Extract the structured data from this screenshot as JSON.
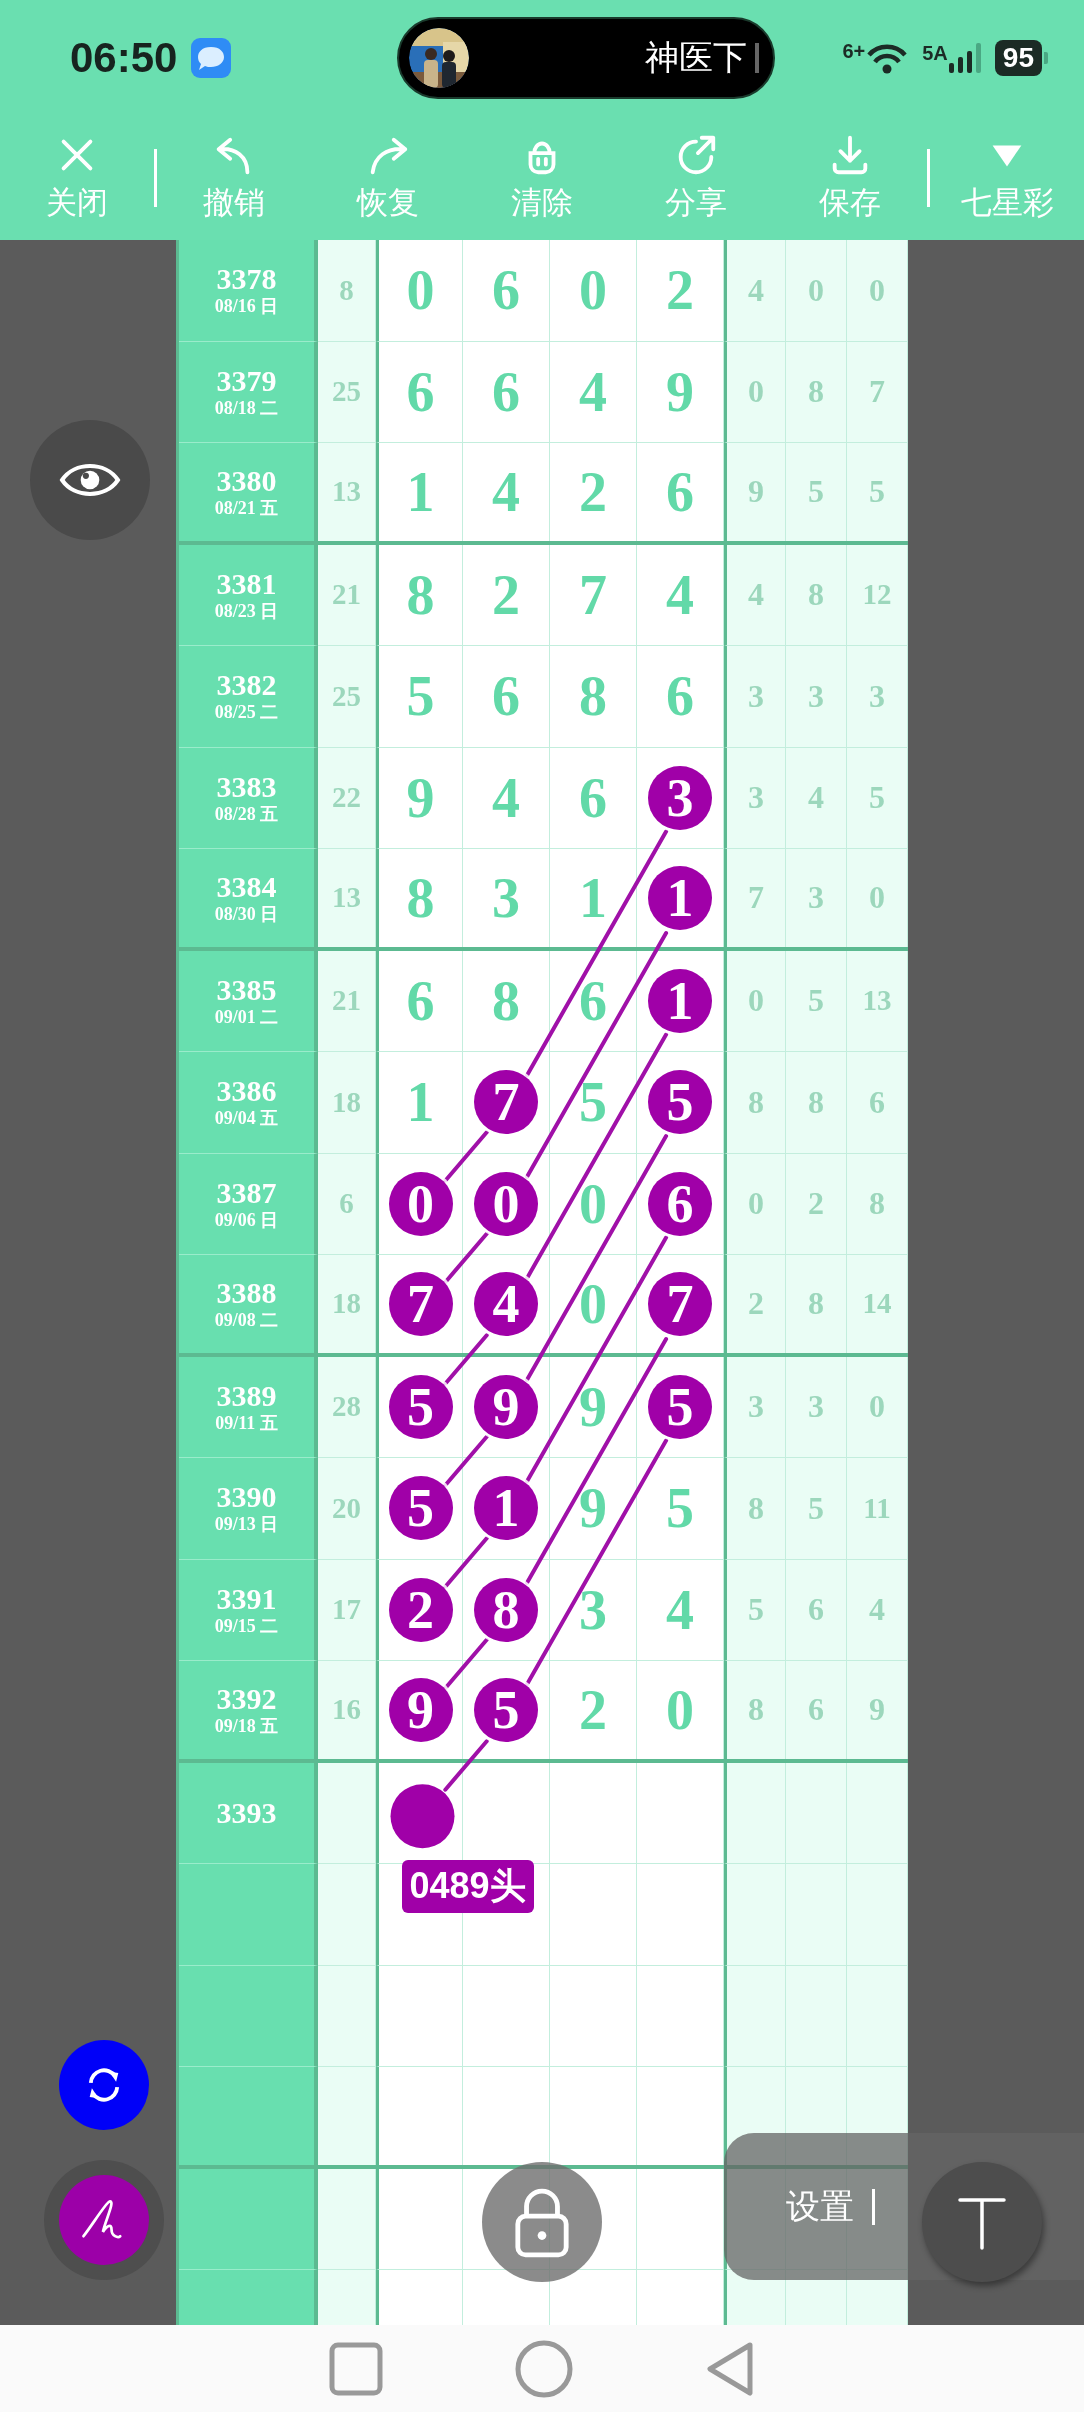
{
  "status_bar": {
    "time": "06:50",
    "media_title": "神医下",
    "wifi_label": "6+",
    "network_label": "5A",
    "battery": "95"
  },
  "toolbar": {
    "items": [
      {
        "kind": "close",
        "label": "关闭",
        "divider_before": false
      },
      {
        "kind": "undo",
        "label": "撤销",
        "divider_before": true
      },
      {
        "kind": "redo",
        "label": "恢复",
        "divider_before": false
      },
      {
        "kind": "clear",
        "label": "清除",
        "divider_before": false
      },
      {
        "kind": "share",
        "label": "分享",
        "divider_before": false
      },
      {
        "kind": "save",
        "label": "保存",
        "divider_before": false
      },
      {
        "kind": "menu",
        "label": "七星彩",
        "divider_before": true
      }
    ]
  },
  "rows": [
    {
      "period": "3378",
      "date": "08/16 日",
      "sum": "8",
      "digits": [
        {
          "value": "0",
          "circled": false
        },
        {
          "value": "6",
          "circled": false
        },
        {
          "value": "0",
          "circled": false
        },
        {
          "value": "2",
          "circled": false
        }
      ],
      "extra": [
        "4",
        "0",
        "0"
      ],
      "divider_below": false
    },
    {
      "period": "3379",
      "date": "08/18 二",
      "sum": "25",
      "digits": [
        {
          "value": "6",
          "circled": false
        },
        {
          "value": "6",
          "circled": false
        },
        {
          "value": "4",
          "circled": false
        },
        {
          "value": "9",
          "circled": false
        }
      ],
      "extra": [
        "0",
        "8",
        "7"
      ],
      "divider_below": false
    },
    {
      "period": "3380",
      "date": "08/21 五",
      "sum": "13",
      "digits": [
        {
          "value": "1",
          "circled": false
        },
        {
          "value": "4",
          "circled": false
        },
        {
          "value": "2",
          "circled": false
        },
        {
          "value": "6",
          "circled": false
        }
      ],
      "extra": [
        "9",
        "5",
        "5"
      ],
      "divider_below": true
    },
    {
      "period": "3381",
      "date": "08/23 日",
      "sum": "21",
      "digits": [
        {
          "value": "8",
          "circled": false
        },
        {
          "value": "2",
          "circled": false
        },
        {
          "value": "7",
          "circled": false
        },
        {
          "value": "4",
          "circled": false
        }
      ],
      "extra": [
        "4",
        "8",
        "12"
      ],
      "divider_below": false
    },
    {
      "period": "3382",
      "date": "08/25 二",
      "sum": "25",
      "digits": [
        {
          "value": "5",
          "circled": false
        },
        {
          "value": "6",
          "circled": false
        },
        {
          "value": "8",
          "circled": false
        },
        {
          "value": "6",
          "circled": false
        }
      ],
      "extra": [
        "3",
        "3",
        "3"
      ],
      "divider_below": false
    },
    {
      "period": "3383",
      "date": "08/28 五",
      "sum": "22",
      "digits": [
        {
          "value": "9",
          "circled": false
        },
        {
          "value": "4",
          "circled": false
        },
        {
          "value": "6",
          "circled": false
        },
        {
          "value": "3",
          "circled": true
        }
      ],
      "extra": [
        "3",
        "4",
        "5"
      ],
      "divider_below": false
    },
    {
      "period": "3384",
      "date": "08/30 日",
      "sum": "13",
      "digits": [
        {
          "value": "8",
          "circled": false
        },
        {
          "value": "3",
          "circled": false
        },
        {
          "value": "1",
          "circled": false
        },
        {
          "value": "1",
          "circled": true
        }
      ],
      "extra": [
        "7",
        "3",
        "0"
      ],
      "divider_below": true
    },
    {
      "period": "3385",
      "date": "09/01 二",
      "sum": "21",
      "digits": [
        {
          "value": "6",
          "circled": false
        },
        {
          "value": "8",
          "circled": false
        },
        {
          "value": "6",
          "circled": false
        },
        {
          "value": "1",
          "circled": true
        }
      ],
      "extra": [
        "0",
        "5",
        "13"
      ],
      "divider_below": false
    },
    {
      "period": "3386",
      "date": "09/04 五",
      "sum": "18",
      "digits": [
        {
          "value": "1",
          "circled": false
        },
        {
          "value": "7",
          "circled": true
        },
        {
          "value": "5",
          "circled": false
        },
        {
          "value": "5",
          "circled": true
        }
      ],
      "extra": [
        "8",
        "8",
        "6"
      ],
      "divider_below": false
    },
    {
      "period": "3387",
      "date": "09/06 日",
      "sum": "6",
      "digits": [
        {
          "value": "0",
          "circled": true
        },
        {
          "value": "0",
          "circled": true
        },
        {
          "value": "0",
          "circled": false
        },
        {
          "value": "6",
          "circled": true
        }
      ],
      "extra": [
        "0",
        "2",
        "8"
      ],
      "divider_below": false
    },
    {
      "period": "3388",
      "date": "09/08 二",
      "sum": "18",
      "digits": [
        {
          "value": "7",
          "circled": true
        },
        {
          "value": "4",
          "circled": true
        },
        {
          "value": "0",
          "circled": false
        },
        {
          "value": "7",
          "circled": true
        }
      ],
      "extra": [
        "2",
        "8",
        "14"
      ],
      "divider_below": true
    },
    {
      "period": "3389",
      "date": "09/11 五",
      "sum": "28",
      "digits": [
        {
          "value": "5",
          "circled": true
        },
        {
          "value": "9",
          "circled": true
        },
        {
          "value": "9",
          "circled": false
        },
        {
          "value": "5",
          "circled": true
        }
      ],
      "extra": [
        "3",
        "3",
        "0"
      ],
      "divider_below": false
    },
    {
      "period": "3390",
      "date": "09/13 日",
      "sum": "20",
      "digits": [
        {
          "value": "5",
          "circled": true
        },
        {
          "value": "1",
          "circled": true
        },
        {
          "value": "9",
          "circled": false
        },
        {
          "value": "5",
          "circled": false
        }
      ],
      "extra": [
        "8",
        "5",
        "11"
      ],
      "divider_below": false
    },
    {
      "period": "3391",
      "date": "09/15 二",
      "sum": "17",
      "digits": [
        {
          "value": "2",
          "circled": true
        },
        {
          "value": "8",
          "circled": true
        },
        {
          "value": "3",
          "circled": false
        },
        {
          "value": "4",
          "circled": false
        }
      ],
      "extra": [
        "5",
        "6",
        "4"
      ],
      "divider_below": false
    },
    {
      "period": "3392",
      "date": "09/18 五",
      "sum": "16",
      "digits": [
        {
          "value": "9",
          "circled": true
        },
        {
          "value": "5",
          "circled": true
        },
        {
          "value": "2",
          "circled": false
        },
        {
          "value": "0",
          "circled": false
        }
      ],
      "extra": [
        "8",
        "6",
        "9"
      ],
      "divider_below": true
    }
  ],
  "pending_row": {
    "period": "3393",
    "dot": true,
    "note": "0489头"
  },
  "settings_panel": {
    "label": "设置"
  }
}
